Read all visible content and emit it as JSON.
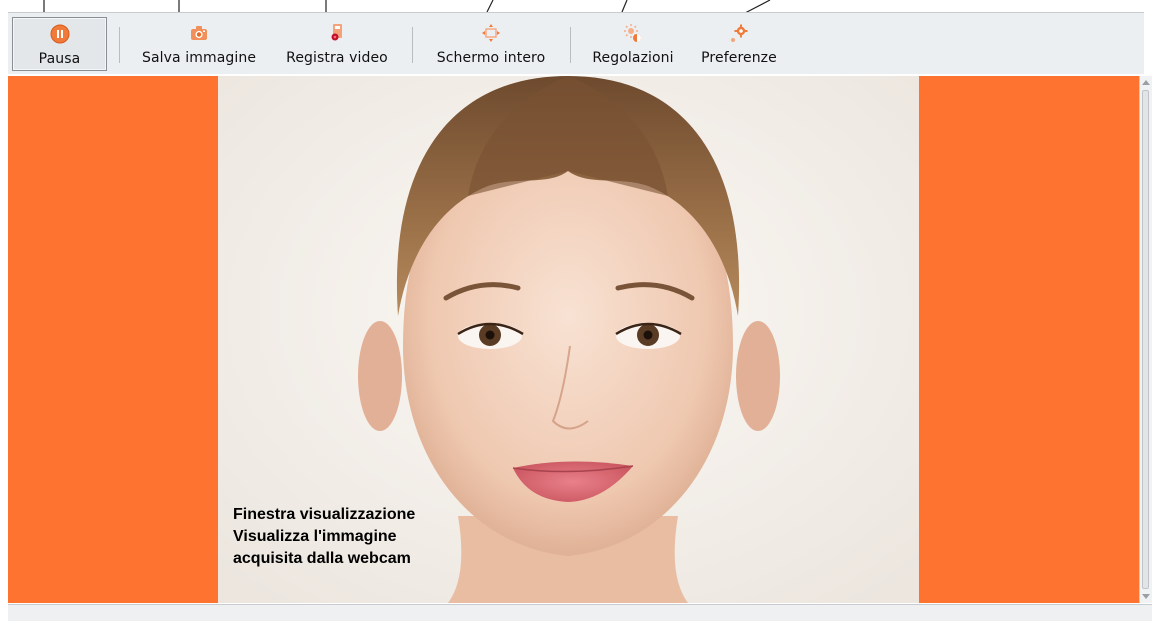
{
  "toolbar": {
    "pause_label": "Pausa",
    "save_image_label": "Salva immagine",
    "record_video_label": "Registra video",
    "fullscreen_label": "Schermo intero",
    "adjustments_label": "Regolazioni",
    "preferences_label": "Preferenze"
  },
  "viewer": {
    "caption_line1": "Finestra visualizzazione",
    "caption_line2": "Visualizza l'immagine",
    "caption_line3": "acquisita dalla webcam"
  },
  "colors": {
    "background": "#ff7330",
    "icon_accent": "#f07a3a",
    "toolbar": "#eceff2"
  },
  "icons": [
    "pause-icon",
    "camera-icon",
    "record-video-icon",
    "fullscreen-icon",
    "adjustments-icon",
    "preferences-icon"
  ]
}
